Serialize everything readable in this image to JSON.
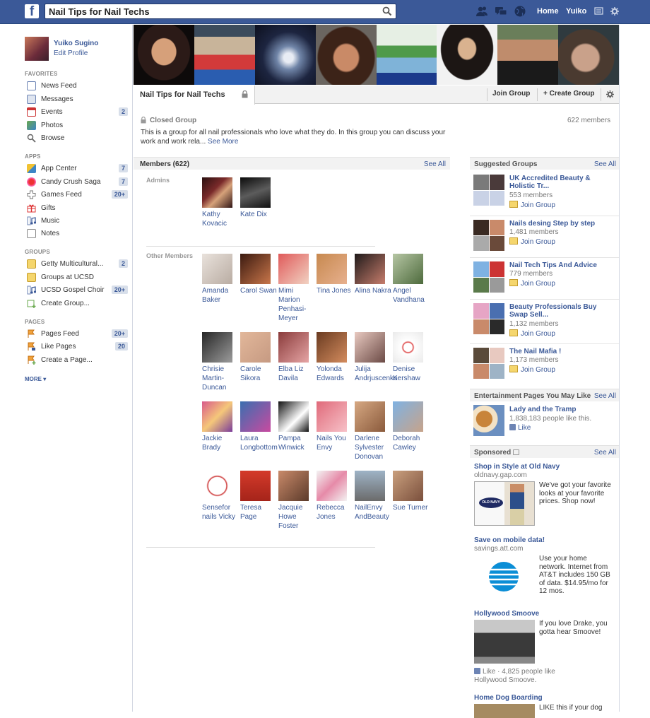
{
  "topbar": {
    "search_value": "Nail Tips for Nail Techs",
    "home_label": "Home",
    "user_label": "Yuiko"
  },
  "profile": {
    "name": "Yuiko Sugino",
    "edit_label": "Edit Profile"
  },
  "sidebar": {
    "favorites_title": "FAVORITES",
    "favorites": [
      {
        "label": "News Feed",
        "count": ""
      },
      {
        "label": "Messages",
        "count": ""
      },
      {
        "label": "Events",
        "count": "2"
      },
      {
        "label": "Photos",
        "count": ""
      },
      {
        "label": "Browse",
        "count": ""
      }
    ],
    "apps_title": "APPS",
    "apps": [
      {
        "label": "App Center",
        "count": "7"
      },
      {
        "label": "Candy Crush Saga",
        "count": "7"
      },
      {
        "label": "Games Feed",
        "count": "20+"
      },
      {
        "label": "Gifts",
        "count": ""
      },
      {
        "label": "Music",
        "count": ""
      },
      {
        "label": "Notes",
        "count": ""
      }
    ],
    "groups_title": "GROUPS",
    "groups": [
      {
        "label": "Getty Multicultural...",
        "count": "2"
      },
      {
        "label": "Groups at UCSD",
        "count": ""
      },
      {
        "label": "UCSD Gospel Choir",
        "count": "20+"
      },
      {
        "label": "Create Group...",
        "count": ""
      }
    ],
    "pages_title": "PAGES",
    "pages": [
      {
        "label": "Pages Feed",
        "count": "20+"
      },
      {
        "label": "Like Pages",
        "count": "20"
      },
      {
        "label": "Create a Page...",
        "count": ""
      }
    ],
    "more_label": "MORE ▾"
  },
  "group": {
    "title": "Nail Tips for Nail Techs",
    "join_label": "Join Group",
    "create_label": "+ Create Group",
    "privacy": "Closed Group",
    "member_count": "622 members",
    "description": "This is a group for all nail professionals who love what they do. In this group you can discuss your work and work rela...",
    "see_more": "See More"
  },
  "members": {
    "title": "Members (622)",
    "see_all": "See All",
    "admins_label": "Admins",
    "admins": [
      "Kathy Kovacic",
      "Kate Dix"
    ],
    "others_label": "Other Members",
    "others": [
      "Amanda Baker",
      "Carol Swan",
      "Mimi Marion Penhasi-Meyer",
      "Tina Jones",
      "Alina Nakra",
      "Angel Vandhana",
      "Chrisie Martin-Duncan",
      "Carole Sikora",
      "Elba Liz Davila",
      "Yolonda Edwards",
      "Julija Andrjuscenko",
      "Denise Kershaw",
      "Jackie Brady",
      "Laura Longbottom",
      "Pampa Winwick",
      "Nails You Envy",
      "Darlene Sylvester Donovan",
      "Deborah Cawley",
      "Sensefor nails Vicky",
      "Teresa Page",
      "Jacquie Howe Foster",
      "Rebecca Jones",
      "NailEnvy AndBeauty",
      "Sue Turner"
    ]
  },
  "suggested": {
    "title": "Suggested Groups",
    "see_all": "See All",
    "join_label": "Join Group",
    "items": [
      {
        "name": "UK Accredited Beauty & Holistic Tr...",
        "members": "553 members"
      },
      {
        "name": "Nails desing Step by step",
        "members": "1,481 members"
      },
      {
        "name": "Nail Tech Tips And Advice",
        "members": "779 members"
      },
      {
        "name": "Beauty Professionals Buy Swap Sell...",
        "members": "1,132 members"
      },
      {
        "name": "The Nail Mafia !",
        "members": "1,173 members"
      }
    ]
  },
  "entertainment": {
    "title": "Entertainment Pages You May Like",
    "see_all": "See All",
    "page_name": "Lady and the Tramp",
    "likes": "1,838,183 people like this.",
    "like_label": "Like"
  },
  "sponsored": {
    "title": "Sponsored",
    "see_all": "See All",
    "ads": [
      {
        "title": "Shop in Style at Old Navy",
        "url": "oldnavy.gap.com",
        "text": "We've got your favorite looks at your favorite prices. Shop now!",
        "logo_text": "OLD NAVY"
      },
      {
        "title": "Save on mobile data!",
        "url": "savings.att.com",
        "text": "Use your home network. Internet from AT&T includes 150 GB of data. $14.95/mo for 12 mos."
      },
      {
        "title": "Hollywood Smoove",
        "url": "",
        "text": "If you love Drake, you gotta hear Smoove!",
        "like_line": "Like · 4,825 people like Hollywood Smoove."
      },
      {
        "title": "Home Dog Boarding",
        "url": "",
        "text": "LIKE this if your dog"
      }
    ]
  },
  "colors": {
    "brand": "#3b5998",
    "topbar_border": "#29487d"
  }
}
